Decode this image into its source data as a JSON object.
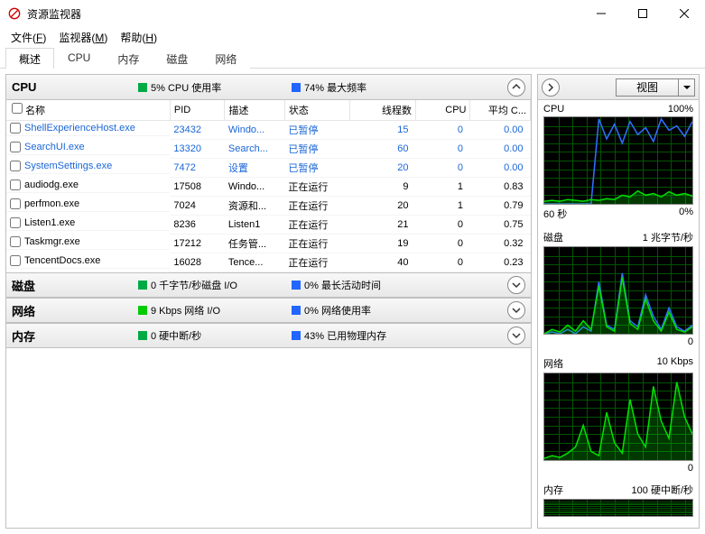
{
  "title": "资源监视器",
  "menu": {
    "file": "文件",
    "file_u": "F",
    "monitor": "监视器",
    "monitor_u": "M",
    "help": "帮助",
    "help_u": "H"
  },
  "tabs": {
    "overview": "概述",
    "cpu": "CPU",
    "memory": "内存",
    "disk": "磁盘",
    "network": "网络"
  },
  "secCpu": {
    "label": "CPU",
    "stat1": "5% CPU 使用率",
    "stat2": "74% 最大频率",
    "cols": {
      "name": "名称",
      "pid": "PID",
      "desc": "描述",
      "status": "状态",
      "threads": "线程数",
      "cpu": "CPU",
      "avg": "平均 C..."
    },
    "rows": [
      {
        "name": "ShellExperienceHost.exe",
        "pid": "23432",
        "desc": "Windo...",
        "status": "已暂停",
        "threads": "15",
        "cpu": "0",
        "avg": "0.00",
        "hl": true
      },
      {
        "name": "SearchUI.exe",
        "pid": "13320",
        "desc": "Search...",
        "status": "已暂停",
        "threads": "60",
        "cpu": "0",
        "avg": "0.00",
        "hl": true
      },
      {
        "name": "SystemSettings.exe",
        "pid": "7472",
        "desc": "设置",
        "status": "已暂停",
        "threads": "20",
        "cpu": "0",
        "avg": "0.00",
        "hl": true
      },
      {
        "name": "audiodg.exe",
        "pid": "17508",
        "desc": "Windo...",
        "status": "正在运行",
        "threads": "9",
        "cpu": "1",
        "avg": "0.83"
      },
      {
        "name": "perfmon.exe",
        "pid": "7024",
        "desc": "资源和...",
        "status": "正在运行",
        "threads": "20",
        "cpu": "1",
        "avg": "0.79"
      },
      {
        "name": "Listen1.exe",
        "pid": "8236",
        "desc": "Listen1",
        "status": "正在运行",
        "threads": "21",
        "cpu": "0",
        "avg": "0.75"
      },
      {
        "name": "Taskmgr.exe",
        "pid": "17212",
        "desc": "任务管...",
        "status": "正在运行",
        "threads": "19",
        "cpu": "0",
        "avg": "0.32"
      },
      {
        "name": "TencentDocs.exe",
        "pid": "16028",
        "desc": "Tence...",
        "status": "正在运行",
        "threads": "40",
        "cpu": "0",
        "avg": "0.23"
      }
    ]
  },
  "secDisk": {
    "label": "磁盘",
    "stat1": "0 千字节/秒磁盘 I/O",
    "stat2": "0% 最长活动时间"
  },
  "secNet": {
    "label": "网络",
    "stat1": "9 Kbps 网络 I/O",
    "stat2": "0% 网络使用率"
  },
  "secMem": {
    "label": "内存",
    "stat1": "0 硬中断/秒",
    "stat2": "43% 已用物理内存"
  },
  "rightView": "视图",
  "graphs": {
    "cpu": {
      "title": "CPU",
      "topRight": "100%",
      "botLeft": "60 秒",
      "botRight": "0%"
    },
    "disk": {
      "title": "磁盘",
      "topRight": "1 兆字节/秒",
      "botRight": "0"
    },
    "net": {
      "title": "网络",
      "topRight": "10 Kbps",
      "botRight": "0"
    },
    "mem": {
      "title": "内存",
      "topRight": "100 硬中断/秒"
    }
  }
}
